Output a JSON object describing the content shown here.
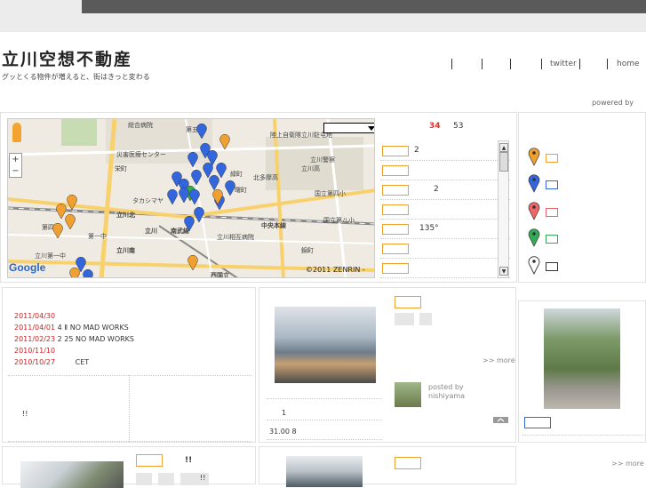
{
  "header": {
    "title": "立川空想不動産",
    "subtitle": "グッとくる物件が増えると、街はきっと変わる",
    "nav": [
      "",
      "",
      "",
      "",
      "twitter",
      "",
      "home"
    ],
    "powered_by": "powered by"
  },
  "map": {
    "copyright": "©2011 ZENRIN -",
    "google": "Google",
    "zoom_in": "+",
    "zoom_out": "−",
    "labels": [
      "総合病院",
      "災害医療センター",
      "第五小",
      "陸上自衛隊立川駐屯地",
      "立川警察",
      "立川高",
      "北多摩高",
      "国立第四小",
      "立川北",
      "立川",
      "南武線",
      "中央本線",
      "立川南",
      "西国立",
      "国立第八小",
      "第四中",
      "第一中",
      "立川第一中",
      "タカシマヤ",
      "立川相互病院",
      "緑町",
      "錦町",
      "栄町",
      "曙町"
    ]
  },
  "list": {
    "count_red": "34",
    "count": "53",
    "rows": [
      {
        "text": "2",
        "indent": false
      },
      {
        "text": "",
        "indent": false
      },
      {
        "text": "2",
        "indent": true
      },
      {
        "text": "",
        "indent": false
      },
      {
        "text": "135°",
        "indent": false
      },
      {
        "text": "",
        "indent": false
      },
      {
        "text": "",
        "indent": false
      }
    ]
  },
  "legend": {
    "colors": [
      "#f0a030",
      "#3366dd",
      "#ee6666",
      "#33aa55",
      "#333333"
    ]
  },
  "dates": [
    {
      "date": "2011/04/30",
      "text": ""
    },
    {
      "date": "2011/04/01",
      "text": "4 Ⅱ  NO MAD WORKS"
    },
    {
      "date": "2011/02/23",
      "text": "2 25  NO MAD WORKS"
    },
    {
      "date": "2010/11/10",
      "text": ""
    },
    {
      "date": "2010/10/27",
      "text": "CET"
    }
  ],
  "dates_note": "!!",
  "mid": {
    "more": ">> more",
    "posted_by": "posted by",
    "author": "nishiyama",
    "num1": "1",
    "meta": "31.00   8"
  },
  "right": {
    "more": ">> more"
  },
  "bottom": {
    "label": "!!",
    "label2": "!!"
  }
}
